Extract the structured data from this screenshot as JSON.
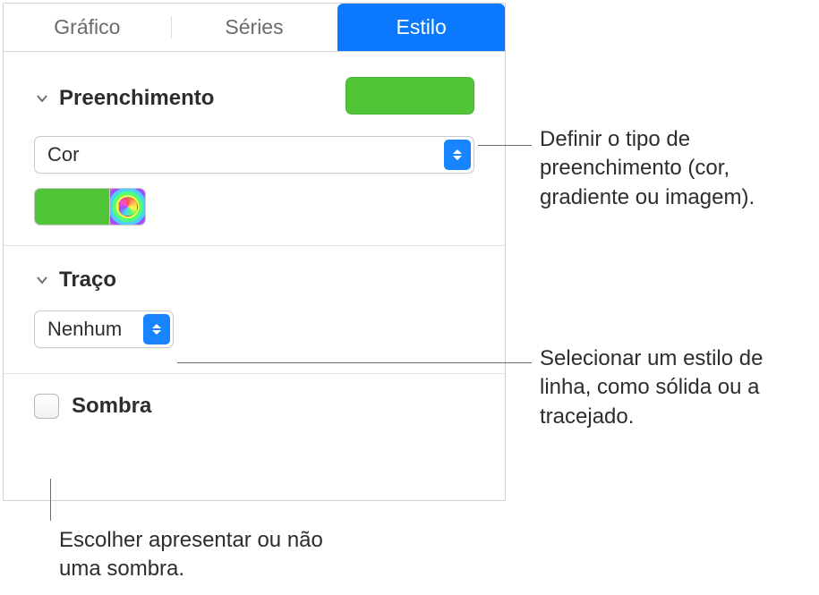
{
  "tabs": {
    "chart": "Gráfico",
    "series": "Séries",
    "style": "Estilo"
  },
  "fill": {
    "title": "Preenchimento",
    "type": "Cor",
    "swatch_color": "#4fc537"
  },
  "stroke": {
    "title": "Traço",
    "value": "Nenhum"
  },
  "shadow": {
    "label": "Sombra"
  },
  "callouts": {
    "fill_type": "Definir o tipo de preenchimento (cor, gradiente ou imagem).",
    "stroke_style": "Selecionar um estilo de linha, como sólida ou a tracejado.",
    "shadow_toggle": "Escolher apresentar ou não uma sombra."
  }
}
